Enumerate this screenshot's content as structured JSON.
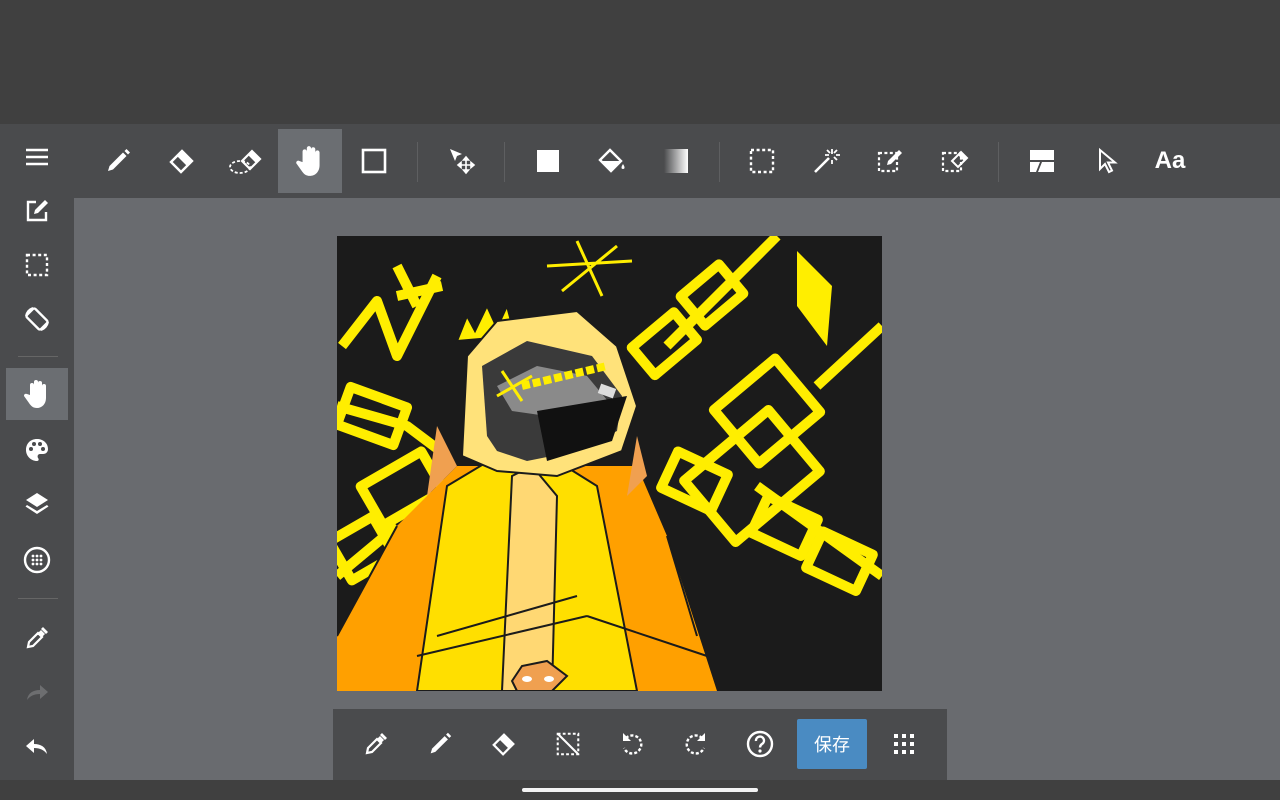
{
  "toolbar": {
    "tools": [
      "pen-tool",
      "eraser-tool",
      "blur-eraser-tool",
      "hand-tool",
      "shape-tool",
      "move-tool",
      "fill-color-tool",
      "bucket-fill-tool",
      "gradient-tool",
      "select-rect-tool",
      "magic-wand-tool",
      "select-pen-tool",
      "select-eraser-tool",
      "divide-panel-tool",
      "pointer-tool",
      "text-tool"
    ],
    "active_tool": "hand-tool",
    "text_tool_label": "Aa"
  },
  "sidebar": {
    "items": [
      "menu",
      "edit",
      "selection",
      "rotate-lock",
      "hand",
      "color-palette",
      "layers",
      "brush-settings",
      "eyedropper",
      "redo",
      "undo"
    ],
    "active_item": "hand"
  },
  "bottom_bar": {
    "items": [
      "eyedropper",
      "pen",
      "eraser",
      "deselect",
      "undo",
      "redo",
      "help",
      "save",
      "grid"
    ],
    "save_label": "保存"
  },
  "colors": {
    "accent": "#4a8bc2",
    "toolbar_bg": "#4a4b4d",
    "workspace_bg": "#696b6f",
    "active_tool_bg": "#6b6e72",
    "canvas_bg": "#1b1b1b",
    "art_yellow": "#ffee00"
  }
}
